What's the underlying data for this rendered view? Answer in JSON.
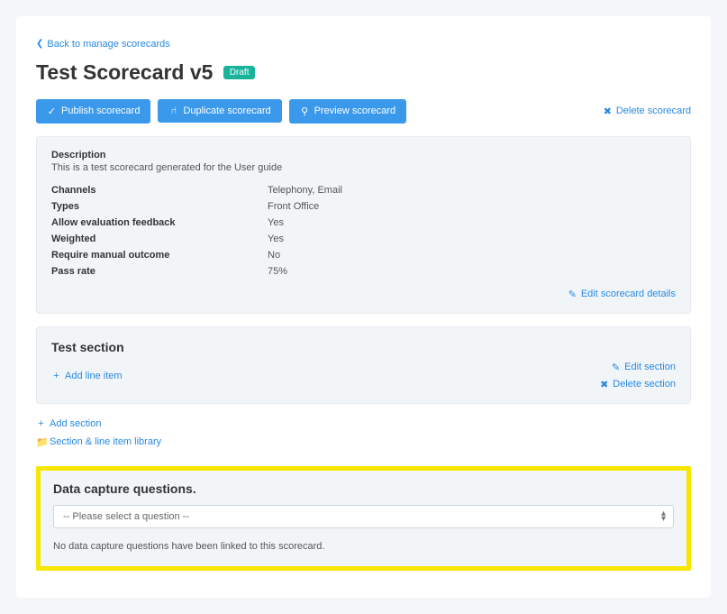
{
  "back_link": {
    "label": "Back to manage scorecards"
  },
  "page": {
    "title": "Test Scorecard v5",
    "status_badge": "Draft"
  },
  "toolbar": {
    "publish": "Publish scorecard",
    "duplicate": "Duplicate scorecard",
    "preview": "Preview scorecard",
    "delete": "Delete scorecard"
  },
  "description": {
    "label": "Description",
    "text": "This is a test scorecard generated for the User guide"
  },
  "details": {
    "channels": {
      "label": "Channels",
      "value": "Telephony, Email"
    },
    "types": {
      "label": "Types",
      "value": "Front Office"
    },
    "allow_feedback": {
      "label": "Allow evaluation feedback",
      "value": "Yes"
    },
    "weighted": {
      "label": "Weighted",
      "value": "Yes"
    },
    "require_manual": {
      "label": "Require manual outcome",
      "value": "No"
    },
    "pass_rate": {
      "label": "Pass rate",
      "value": "75%"
    },
    "edit_link": "Edit scorecard details"
  },
  "section": {
    "title": "Test section",
    "add_line_item": "Add line item",
    "edit": "Edit section",
    "delete": "Delete section"
  },
  "below": {
    "add_section": "Add section",
    "library": "Section & line item library"
  },
  "data_capture": {
    "title": "Data capture questions.",
    "placeholder": "-- Please select a question --",
    "empty_message": "No data capture questions have been linked to this scorecard."
  }
}
